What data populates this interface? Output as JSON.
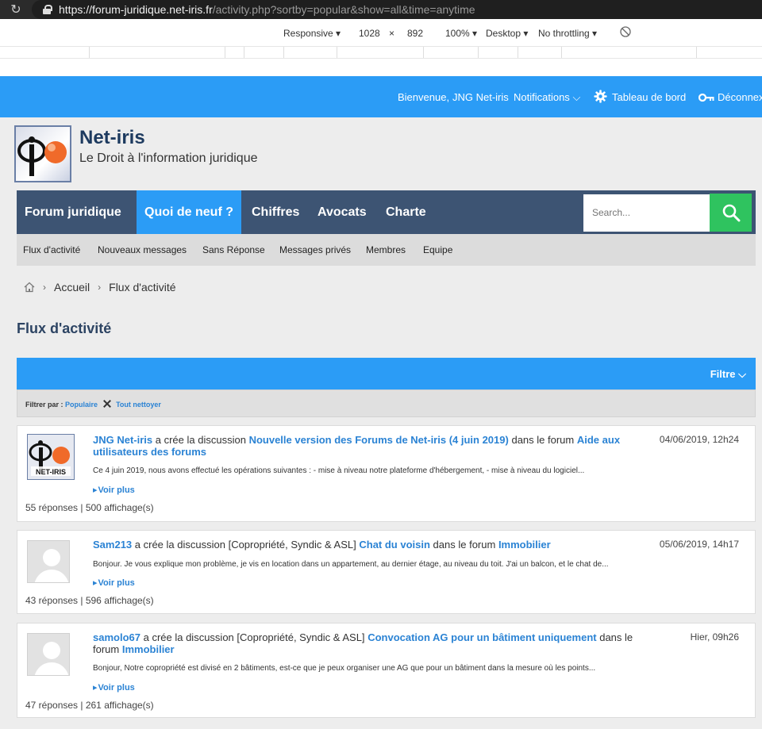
{
  "browser": {
    "url_host": "https://forum-juridique.net-iris.fr",
    "url_path": "/activity.php?sortby=popular&show=all&time=anytime",
    "device": "Responsive",
    "width": "1028",
    "times": "×",
    "height": "892",
    "zoom": "100%",
    "mode": "Desktop",
    "throttling": "No throttling"
  },
  "topbar": {
    "welcome": "Bienvenue,",
    "username": "JNG Net-iris",
    "notifications": "Notifications",
    "dashboard": "Tableau de bord",
    "logout": "Déconnex"
  },
  "header": {
    "title": "Net-iris",
    "tagline": "Le Droit à l'information juridique",
    "logo_text": "NET-IRIS"
  },
  "nav": {
    "tabs": [
      "Forum juridique",
      "Quoi de neuf ?",
      "Chiffres",
      "Avocats",
      "Charte"
    ],
    "search_placeholder": "Search...",
    "subitems": [
      "Flux d'activité",
      "Nouveaux messages",
      "Sans Réponse",
      "Messages privés",
      "Membres",
      "Equipe"
    ]
  },
  "breadcrumb": {
    "sep": "›",
    "home": "Accueil",
    "current": "Flux d'activité"
  },
  "page": {
    "title": "Flux d'activité"
  },
  "filter": {
    "button": "Filtre",
    "label": "Filtrer par :",
    "active": "Populaire",
    "clear": "Tout nettoyer"
  },
  "activities": [
    {
      "user": "JNG Net-iris",
      "action": "a crée la discussion",
      "prefix": "",
      "thread": "Nouvelle version des Forums de Net-iris (4 juin 2019)",
      "in_forum": "dans le forum",
      "forum": "Aide aux utilisateurs des forums",
      "date": "04/06/2019, 12h24",
      "excerpt": "Ce 4 juin 2019, nous avons effectué les opérations suivantes : - mise à niveau notre plateforme d'hébergement, - mise à niveau du logiciel...",
      "more": "Voir plus",
      "stats": "55 réponses | 500 affichage(s)"
    },
    {
      "user": "Sam213",
      "action": "a crée la discussion",
      "prefix": "[Copropriété, Syndic & ASL]",
      "thread": "Chat du voisin",
      "in_forum": "dans le forum",
      "forum": "Immobilier",
      "date": "05/06/2019, 14h17",
      "excerpt": "Bonjour. Je vous explique mon problème, je vis en location dans un appartement, au dernier étage, au niveau du toit. J'ai un balcon, et le chat de...",
      "more": "Voir plus",
      "stats": "43 réponses | 596 affichage(s)"
    },
    {
      "user": "samolo67",
      "action": "a crée la discussion",
      "prefix": "[Copropriété, Syndic & ASL]",
      "thread": "Convocation AG pour un bâtiment uniquement",
      "in_forum": "dans le forum",
      "forum": "Immobilier",
      "date": "Hier, 09h26",
      "excerpt": "Bonjour, Notre copropriété est divisé en 2 bâtiments, est-ce que je peux organiser une AG que pour un bâtiment dans la mesure où les points...",
      "more": "Voir plus",
      "stats": "47 réponses | 261 affichage(s)"
    }
  ]
}
